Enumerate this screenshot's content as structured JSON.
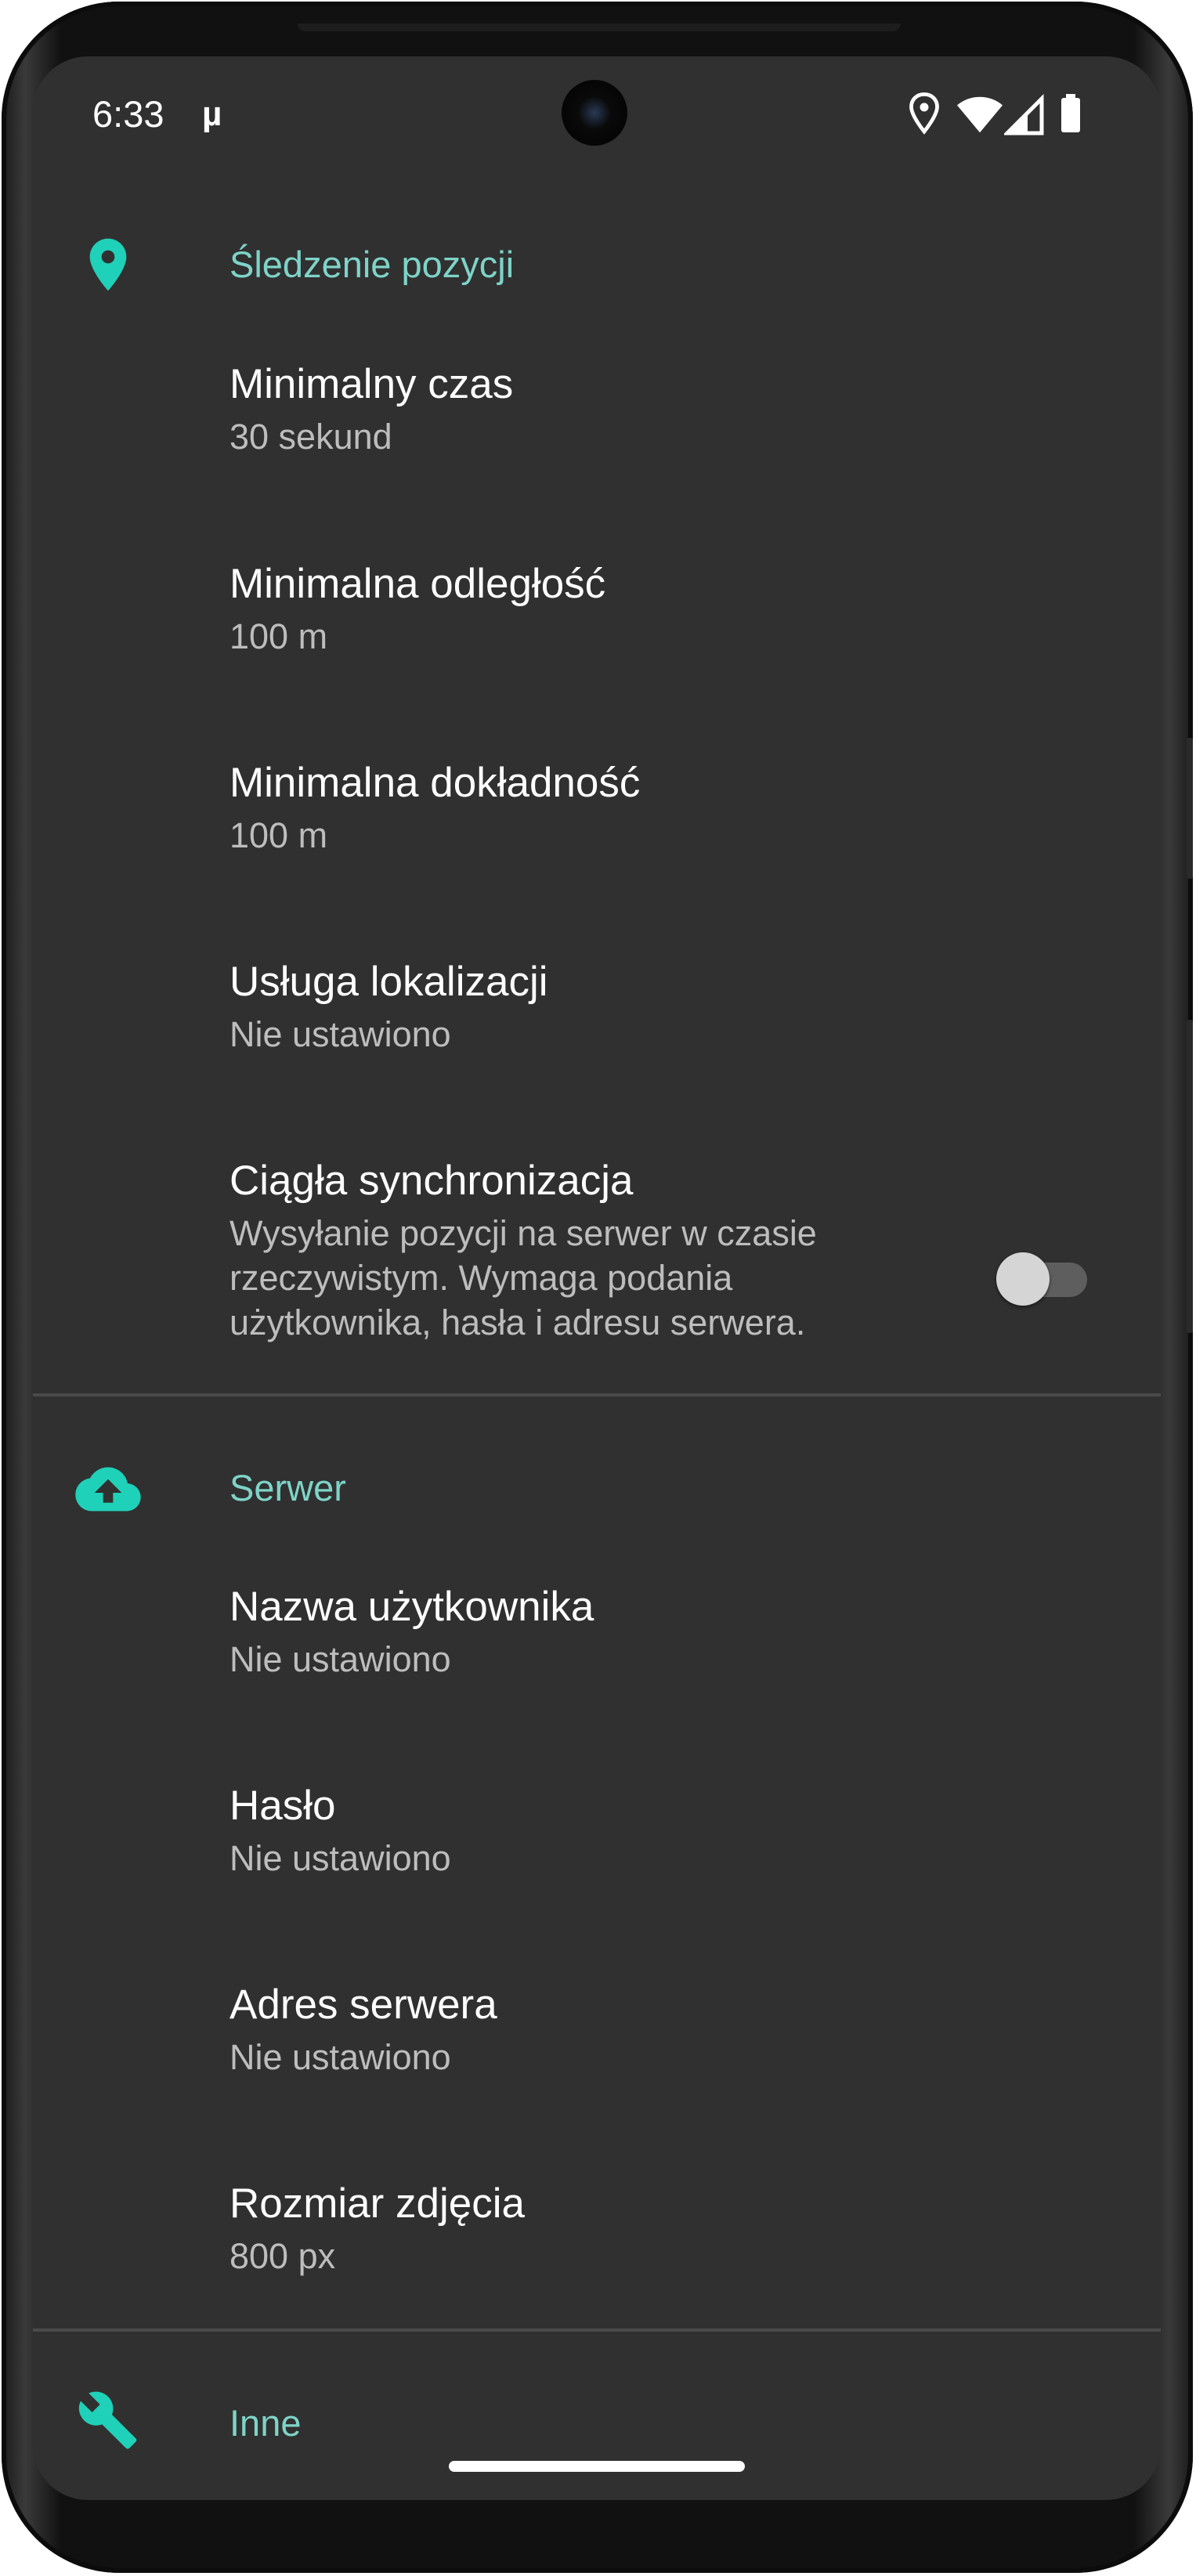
{
  "status_bar": {
    "time": "6:33",
    "app_indicator": "µ",
    "icons": [
      "location-icon",
      "wifi-icon",
      "cell-signal-icon",
      "battery-icon"
    ]
  },
  "accent_color": "#7ed3c8",
  "icon_color": "#1fd1b8",
  "sections": [
    {
      "icon": "location-pin-icon",
      "title": "Śledzenie pozycji",
      "items": [
        {
          "title": "Minimalny czas",
          "summary": "30 sekund"
        },
        {
          "title": "Minimalna odległość",
          "summary": "100 m"
        },
        {
          "title": "Minimalna dokładność",
          "summary": "100 m"
        },
        {
          "title": "Usługa lokalizacji",
          "summary": "Nie ustawiono"
        },
        {
          "title": "Ciągła synchronizacja",
          "summary_lines": [
            "Wysyłanie pozycji na serwer w czasie",
            "rzeczywistym. Wymaga podania",
            "użytkownika, hasła i adresu serwera."
          ],
          "toggle": false
        }
      ]
    },
    {
      "icon": "cloud-upload-icon",
      "title": "Serwer",
      "items": [
        {
          "title": "Nazwa użytkownika",
          "summary": "Nie ustawiono"
        },
        {
          "title": "Hasło",
          "summary": "Nie ustawiono"
        },
        {
          "title": "Adres serwera",
          "summary": "Nie ustawiono"
        },
        {
          "title": "Rozmiar zdjęcia",
          "summary": "800 px"
        }
      ]
    },
    {
      "icon": "wrench-icon",
      "title": "Inne",
      "items": []
    }
  ]
}
